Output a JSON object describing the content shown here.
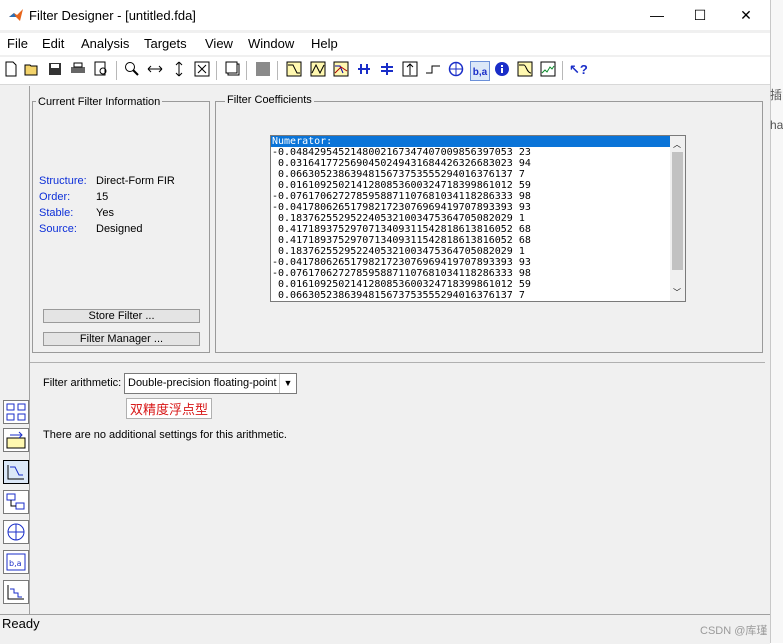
{
  "window": {
    "title": "Filter Designer -  [untitled.fda]",
    "minimize_glyph": "—",
    "maximize_glyph": "☐",
    "close_glyph": "✕"
  },
  "menu": [
    "File",
    "Edit",
    "Analysis",
    "Targets",
    "View",
    "Window",
    "Help"
  ],
  "toolbar_icons": [
    "new-icon",
    "open-icon",
    "save-icon",
    "print-icon",
    "print-preview-icon",
    "zoom-in-icon",
    "zoom-x-icon",
    "zoom-y-icon",
    "full-view-icon",
    "new-figure-icon",
    "grid-icon",
    "magnitude-response-icon",
    "phase-response-icon",
    "magnitude-phase-icon",
    "group-delay-icon",
    "phase-delay-icon",
    "impulse-response-icon",
    "step-response-icon",
    "pole-zero-icon",
    "filter-coefficients-icon",
    "filter-info-icon",
    "magnitude-estimate-icon",
    "round-off-noise-icon",
    "whats-this-icon"
  ],
  "current_filter": {
    "label": "Current Filter Information",
    "rows": [
      {
        "key": "Structure:",
        "value": "Direct-Form FIR"
      },
      {
        "key": "Order:",
        "value": "15"
      },
      {
        "key": "Stable:",
        "value": "Yes"
      },
      {
        "key": "Source:",
        "value": "Designed"
      }
    ],
    "store_button": "Store Filter ...",
    "manager_button": "Filter Manager ..."
  },
  "coefficients": {
    "label": "Filter Coefficients",
    "lines": [
      "Numerator:",
      "-0.0484295452148002167347407009856397053 23",
      " 0.0316417725690450249431684426326683023 94",
      " 0.0663052386394815673753555294016376137 7",
      " 0.0161092502141280853600324718399861012 59",
      "-0.0761706272785958871107681034118286333 98",
      "-0.0417806265179821723076969419707893393 93",
      " 0.1837625529522405321003475364705082029 1",
      " 0.4171893752970713409311542818613816052 68",
      " 0.4171893752970713409311542818613816052 68",
      " 0.1837625529522405321003475364705082029 1",
      "-0.0417806265179821723076969419707893393 93",
      "-0.0761706272785958871107681034118286333 98",
      " 0.0161092502141280853600324718399861012 59",
      " 0.0663052386394815673753555294016376137 7"
    ],
    "selected_index": 0
  },
  "arithmetic": {
    "label": "Filter arithmetic:",
    "selected": "Double-precision floating-point",
    "annotation": "双精度浮点型",
    "note": "There are no additional settings for this arithmetic."
  },
  "side_buttons": [
    "transform-filter-icon",
    "create-multirate-icon",
    "design-filter-icon",
    "realize-model-icon",
    "pole-zero-editor-icon",
    "import-filter-icon",
    "set-quantization-icon"
  ],
  "status": "Ready",
  "background": {
    "fragments": [
      "插",
      "ha"
    ],
    "watermark": "CSDN @库瑾"
  }
}
